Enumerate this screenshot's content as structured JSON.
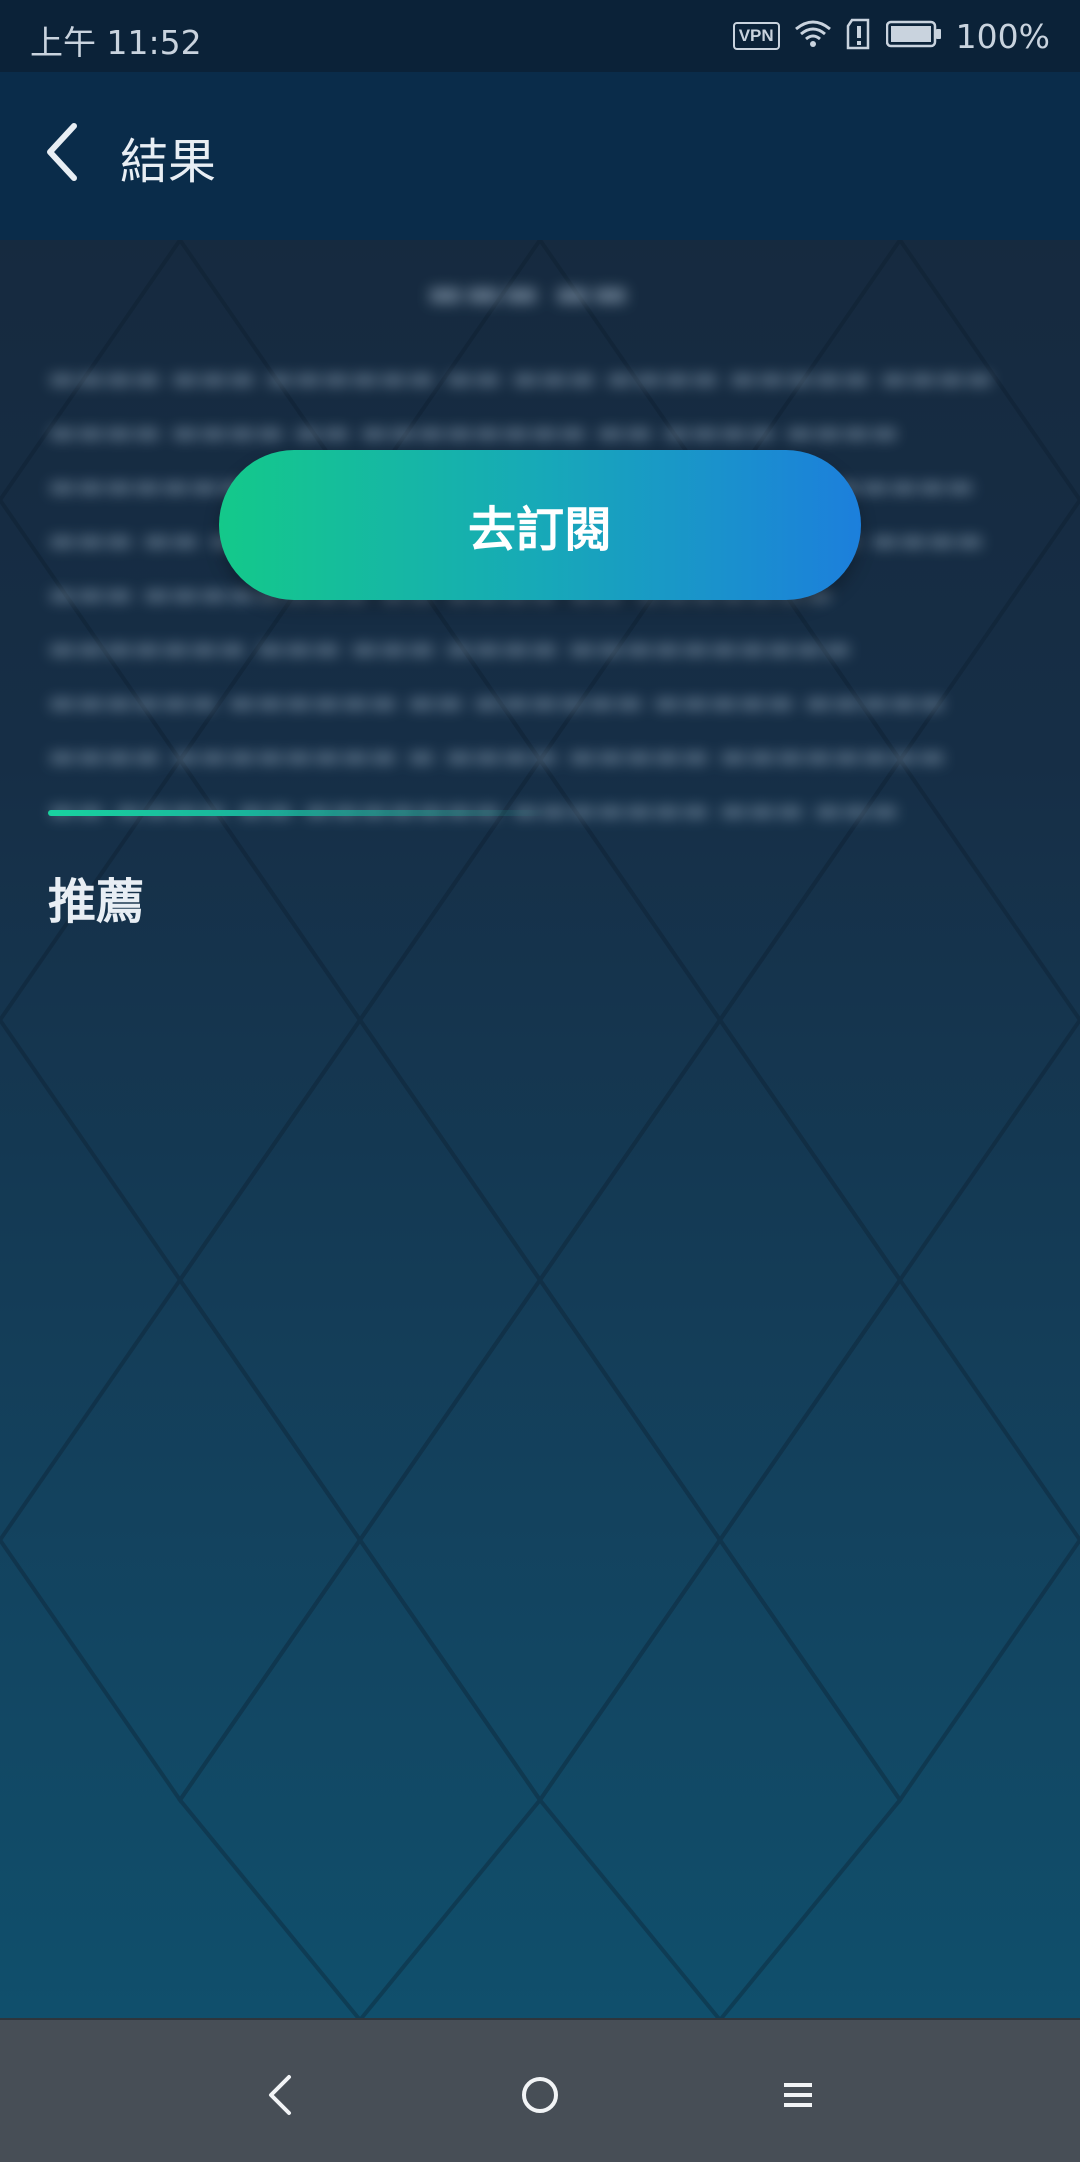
{
  "status_bar": {
    "time": "上午 11:52",
    "vpn_label": "VPN",
    "battery": "100%"
  },
  "header": {
    "title": "結果",
    "back_icon": "chevron-left-icon"
  },
  "content": {
    "subscribe_label": "去訂閱",
    "section_title": "推薦"
  },
  "nav_bar": {
    "items": [
      "back-icon",
      "home-icon",
      "menu-icon"
    ]
  },
  "colors": {
    "accent_start": "#14c98a",
    "accent_end": "#1c7fdc",
    "appbar": "#0a2c4a",
    "navbar": "#474e56"
  }
}
